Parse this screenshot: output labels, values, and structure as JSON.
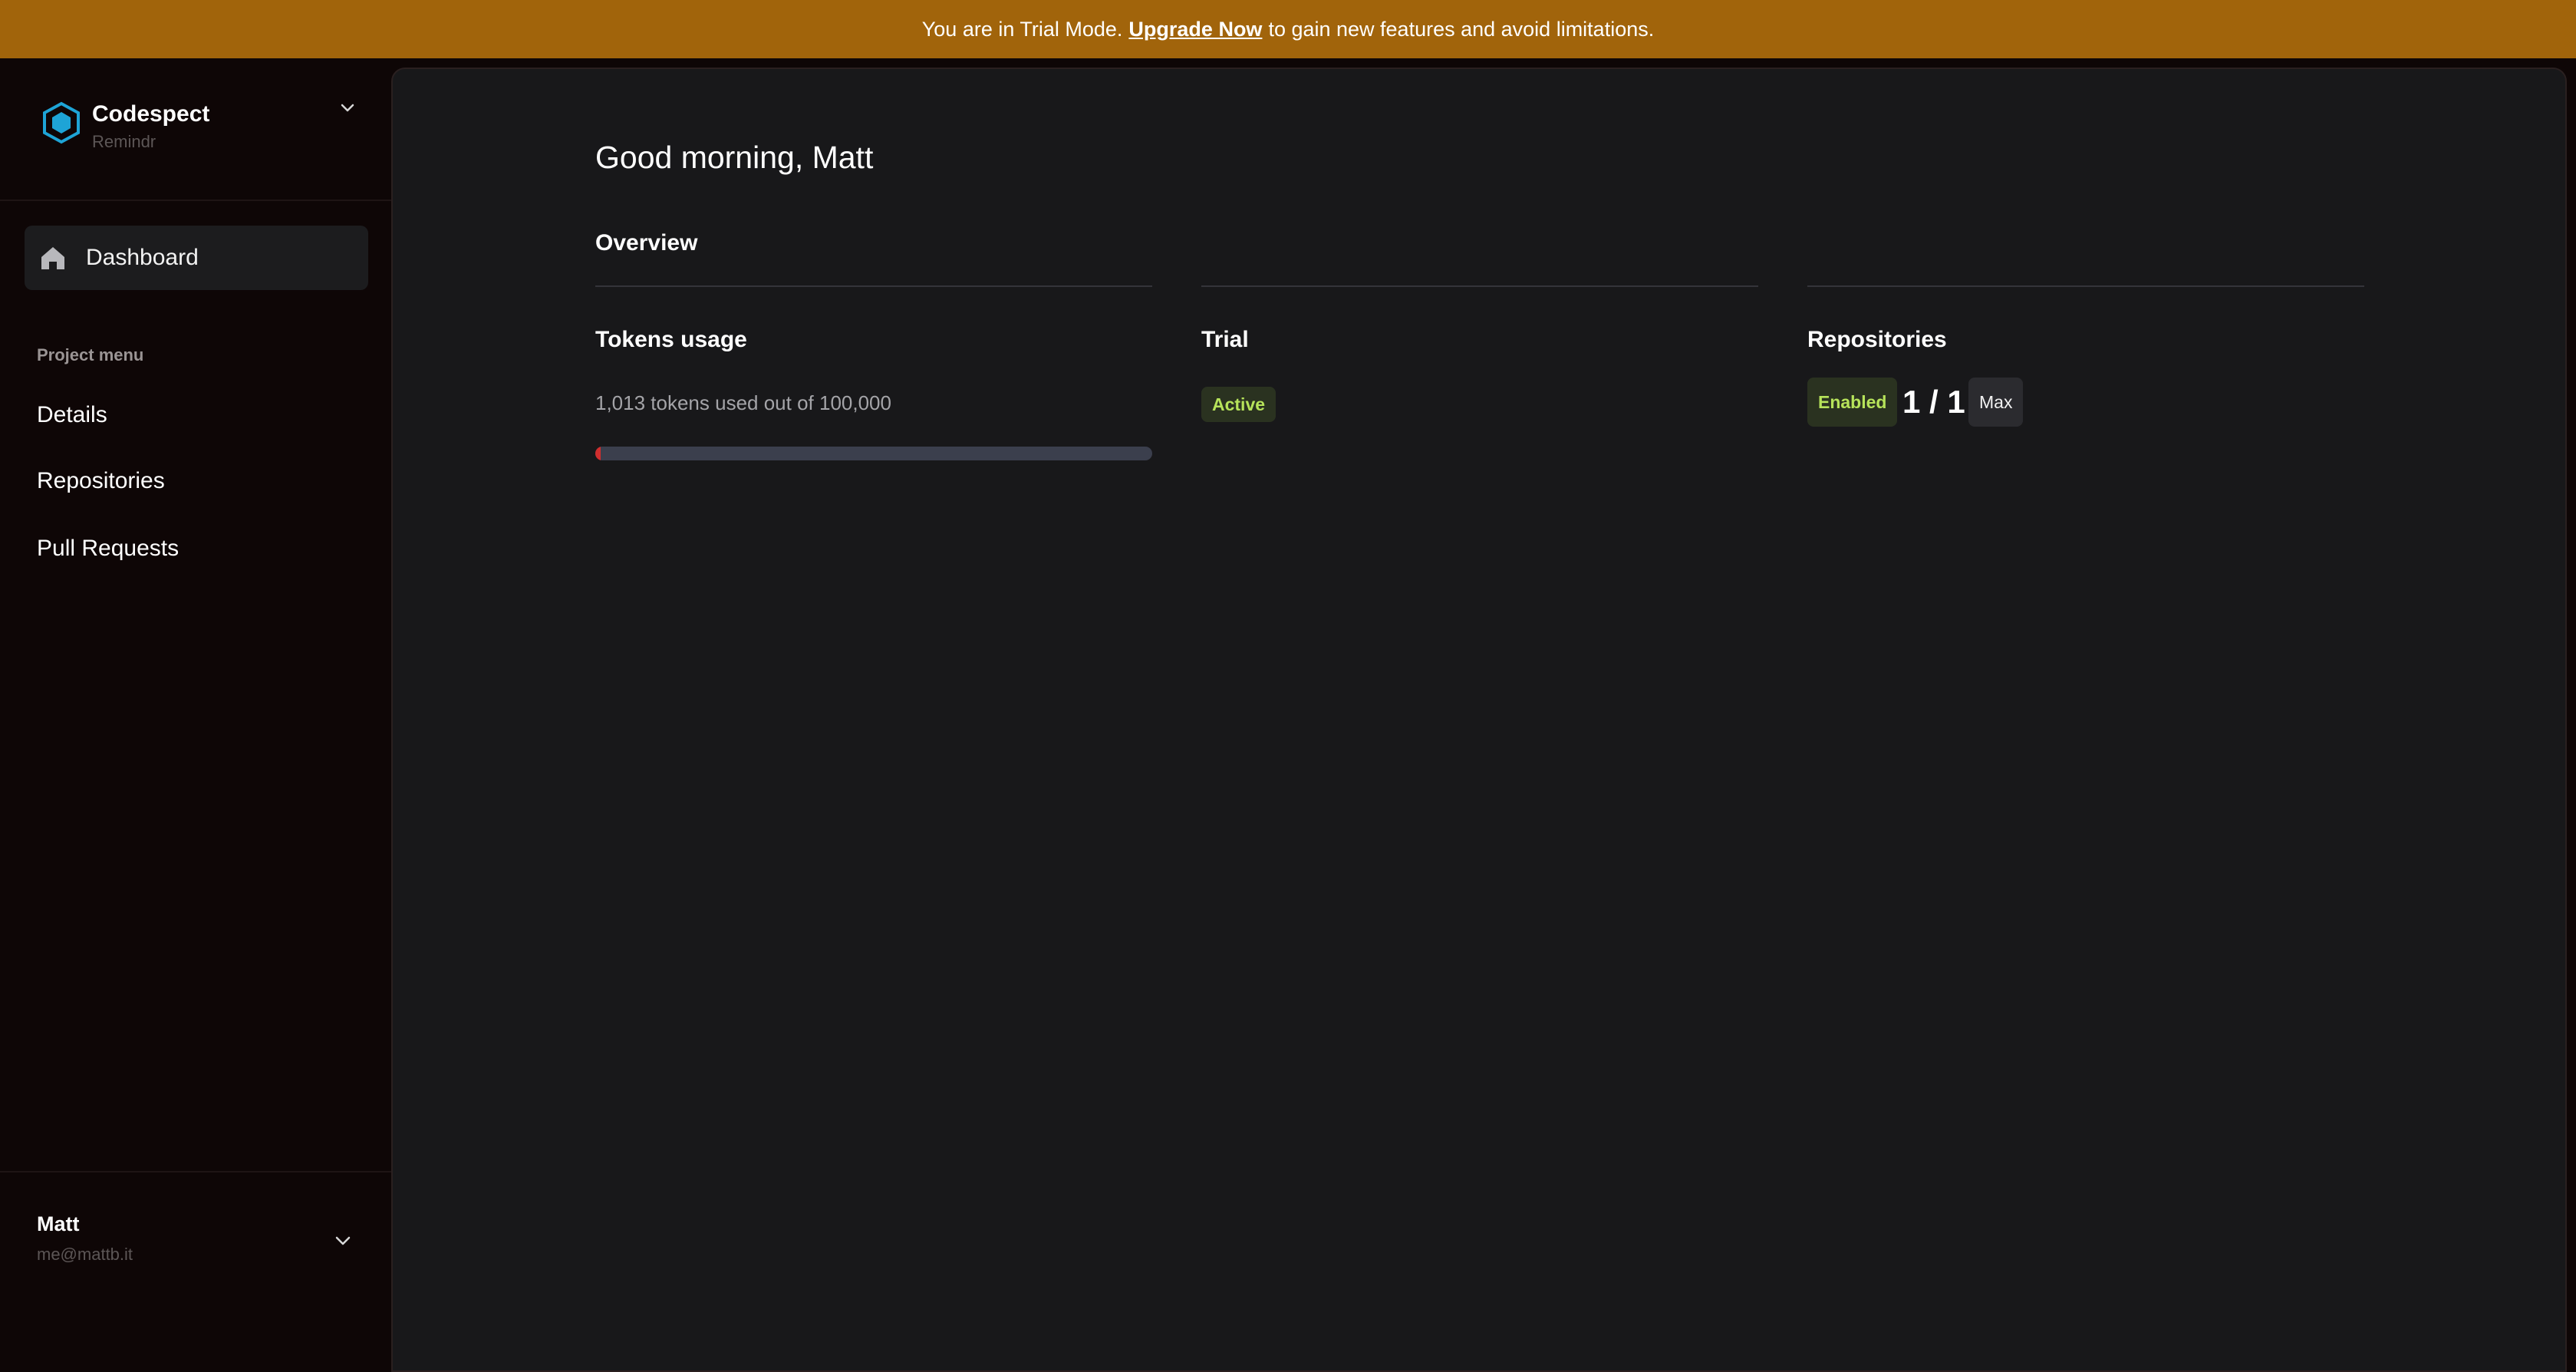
{
  "banner": {
    "prefix": "You are in Trial Mode.",
    "link": "Upgrade Now",
    "suffix": "to gain new features and avoid limitations.",
    "color": "#a1640b"
  },
  "sidebar": {
    "brand": {
      "name": "Codespect",
      "project": "Remindr",
      "logo_icon": "hexagon-logo-icon",
      "accent": "#1ea4d6"
    },
    "active_item": {
      "label": "Dashboard",
      "icon": "home-icon"
    },
    "menu_title": "Project menu",
    "items": [
      {
        "label": "Details"
      },
      {
        "label": "Repositories"
      },
      {
        "label": "Pull Requests"
      }
    ],
    "user": {
      "name": "Matt",
      "email": "me@mattb.it"
    }
  },
  "main": {
    "greeting": "Good morning, Matt",
    "section_title": "Overview",
    "tokens": {
      "title": "Tokens usage",
      "description": "1,013 tokens used out of 100,000",
      "used": 1013,
      "total": 100000,
      "bar_color": "#cf2e2e"
    },
    "trial": {
      "title": "Trial",
      "status": "Active"
    },
    "repositories": {
      "title": "Repositories",
      "status": "Enabled",
      "count": "1 / 1",
      "limit_label": "Max"
    }
  }
}
